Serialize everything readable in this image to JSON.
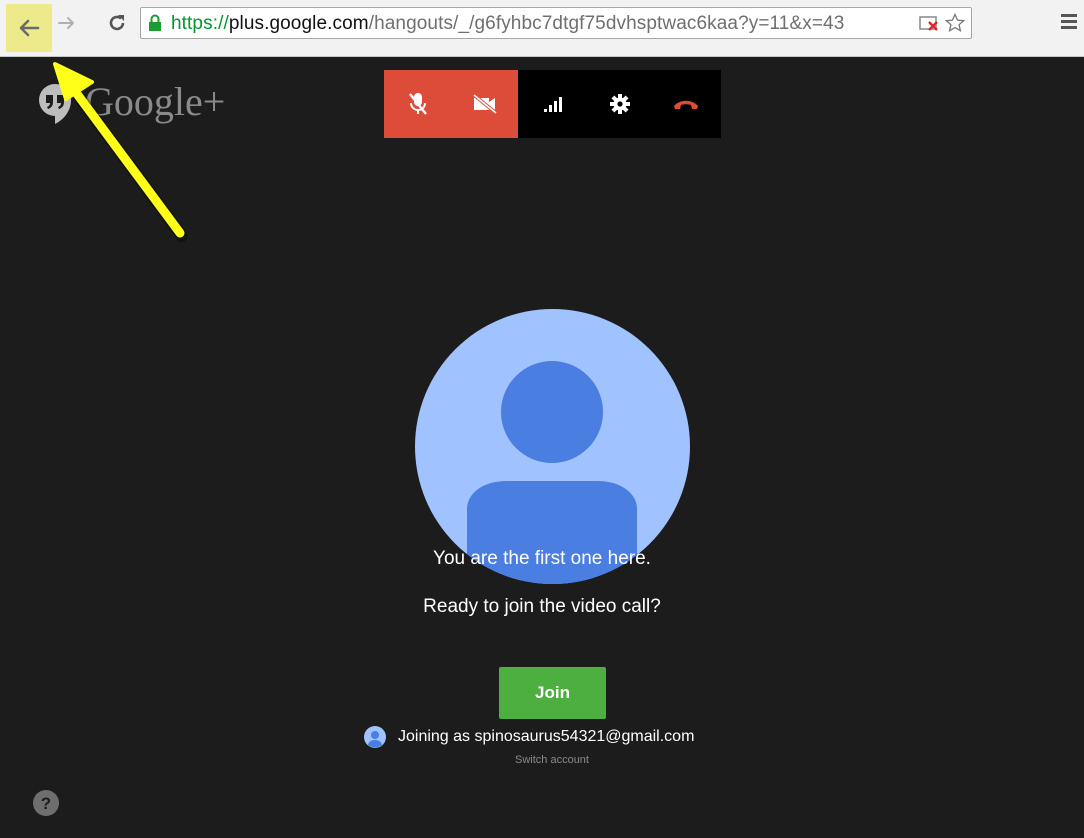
{
  "browser": {
    "url_scheme": "https://",
    "url_host": "plus.google.com",
    "url_rest": "/hangouts/_/g6fyhbc7dtgf75dvhsptwac6kaa?y=11&x=43",
    "icons": [
      "back-arrow-icon",
      "forward-arrow-icon",
      "reload-icon",
      "lock-icon",
      "extension-icon",
      "star-icon",
      "menu-icon"
    ]
  },
  "brand": {
    "text": "Google+",
    "icon": "hangouts-quote-icon"
  },
  "call_controls": {
    "items": [
      "mic-muted-icon",
      "camera-off-icon",
      "signal-icon",
      "settings-gear-icon",
      "hang-up-icon"
    ],
    "accent_red": "#dd4b39"
  },
  "main": {
    "line1": "You are the first one here.",
    "line2": "Ready to join the video call?",
    "join_label": "Join",
    "joining_text": "Joining as spinosaurus54321@gmail.com",
    "switch_account": "Switch account",
    "join_color": "#4caf3f",
    "avatar_bg": "#a0c3ff",
    "avatar_fg": "#4a7ee0"
  },
  "help_icon": "help-icon",
  "annotation": {
    "arrow_color": "#ffff1a",
    "highlight_color": "#ecea8a"
  }
}
